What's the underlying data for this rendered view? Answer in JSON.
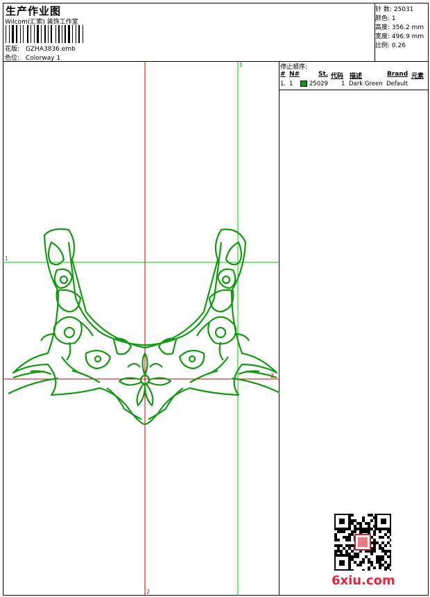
{
  "header": {
    "title": "生产作业图",
    "studio": "Wilcom(汇索) 装饰工作室",
    "pattern_label": "花版:",
    "pattern_value": "GZHA3836.emb",
    "color_label": "色位:",
    "color_value": "Colorway 1"
  },
  "stats": [
    {
      "label": "针 数:",
      "value": "25031"
    },
    {
      "label": "颜色:",
      "value": "1"
    },
    {
      "label": "高度:",
      "value": "356.2 mm"
    },
    {
      "label": "宽度:",
      "value": "496.9 mm"
    },
    {
      "label": "比例:",
      "value": "0.26"
    }
  ],
  "stop_sequence": {
    "heading": "停止顺序:",
    "columns": [
      "#",
      "N#",
      "St.",
      "代码",
      "描述",
      "Brand",
      "元素"
    ],
    "rows": [
      {
        "index": "1.",
        "n": "1",
        "color": "#119911",
        "st": "25029",
        "code": "1",
        "desc": "Dark Green",
        "brand": "Default"
      }
    ]
  },
  "guides": {
    "v1": "1",
    "h1": "1",
    "h2": "2",
    "v2": "2"
  },
  "watermark": "6xiu.com",
  "colors": {
    "thread": "#119911",
    "guide_red": "#cc0000",
    "guide_green": "#00cc00"
  }
}
